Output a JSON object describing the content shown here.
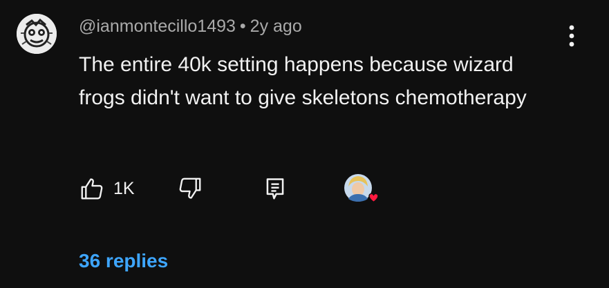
{
  "comment": {
    "author": "@ianmontecillo1493",
    "separator": "•",
    "time": "2y ago",
    "text": "The entire 40k setting happens because wizard frogs didn't want to give skeletons chemotherapy",
    "like_count": "1K",
    "replies_label": "36 replies"
  },
  "icons": {
    "avatar": "avatar-image",
    "more": "more-vert-icon",
    "like": "thumb-up-icon",
    "dislike": "thumb-down-icon",
    "reply": "comment-reply-icon",
    "creator_heart": "creator-heart-icon"
  },
  "colors": {
    "background": "#0f0f0f",
    "text": "#f1f1f1",
    "muted": "#aaaaaa",
    "link": "#3ea6ff",
    "heart": "#ff0033"
  }
}
